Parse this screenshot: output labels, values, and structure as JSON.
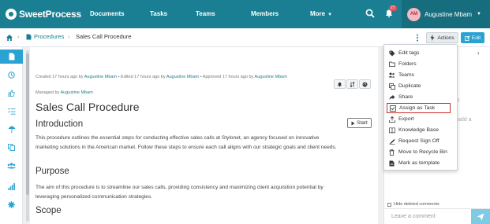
{
  "app": {
    "logo_text": "SweetProcess",
    "nav": [
      "Documents",
      "Tasks",
      "Teams",
      "Members",
      "More"
    ],
    "notification_count": "27",
    "user_initials": "AM",
    "user_name": "Augustine Mbam",
    "accent": "#1a7f93"
  },
  "breadcrumb": {
    "parent": "Procedures",
    "current": "Sales Call Procedure"
  },
  "toolbar": {
    "actions_label": "Actions",
    "edit_label": "Edit"
  },
  "actions_menu": {
    "items": [
      "Edit tags",
      "Folders",
      "Teams",
      "Duplicate",
      "Share",
      "Assign as Task",
      "Export",
      "Knowledge Base",
      "Request Sign Off",
      "Move to Recycle Bin",
      "Mark as template"
    ],
    "highlighted": "Assign as Task",
    "icons": [
      "tag-icon",
      "folder-icon",
      "users-icon",
      "copy-icon",
      "share-icon",
      "check-square-icon",
      "upload-icon",
      "book-icon",
      "sign-icon",
      "trash-icon",
      "template-icon"
    ]
  },
  "meta": {
    "created_prefix": "Created 17 hours ago by ",
    "created_by": "Augustine Mbam",
    "edited_prefix": " • Edited 17 hours ago by ",
    "edited_by": "Augustine Mbam",
    "approved_prefix": " • Approved 17 hours ago by ",
    "approved_by": "Augustine Mbam",
    "managed_prefix": "Managed by ",
    "managed_by": "Augustine Mbam"
  },
  "document": {
    "title": "Sales Call Procedure",
    "start_label": "Start",
    "sections": [
      {
        "heading": "Introduction",
        "body": "This procedure outlines the essential steps for conducting effective sales calls at Stylonet, an agency focused on innovative marketing solutions in the American market. Follow these steps to ensure each call aligns with our strategic goals and client needs."
      },
      {
        "heading": "Purpose",
        "body": "The aim of this procedure is to streamline our sales calls, providing consistency and maximizing client acquisition potential by leveraging personalized communication strategies."
      },
      {
        "heading": "Scope",
        "body": ""
      }
    ]
  },
  "comments": {
    "hide_deleted_label": "Hide deleted comments",
    "placeholder": "Leave a comment",
    "bg_fragment_1": "s",
    "bg_fragment_2": "add a"
  },
  "rail_icons": [
    "document-icon",
    "clock-icon",
    "thumbs-up-icon",
    "list-check-icon",
    "umbrella-icon",
    "copy-icon",
    "team-icon",
    "chart-icon",
    "settings-icon"
  ]
}
